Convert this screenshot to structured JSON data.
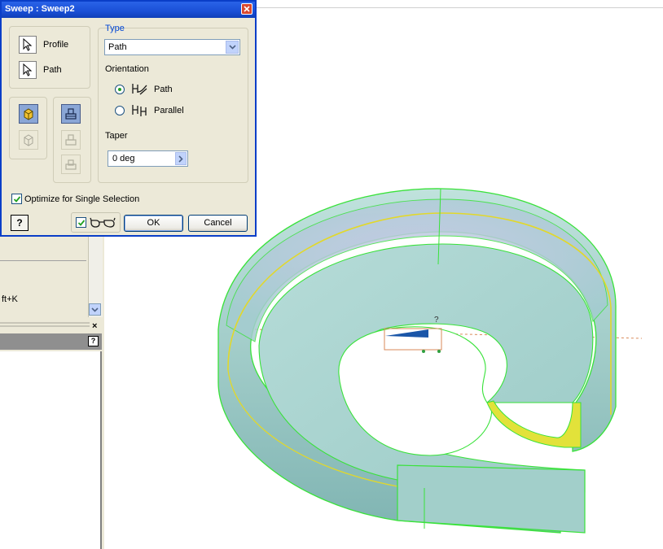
{
  "dialog": {
    "title": "Sweep : Sweep2",
    "selection": {
      "profile_label": "Profile",
      "path_label": "Path"
    },
    "type": {
      "title": "Type",
      "value": "Path"
    },
    "orientation": {
      "title": "Orientation",
      "options": [
        {
          "label": "Path",
          "selected": true
        },
        {
          "label": "Parallel",
          "selected": false
        }
      ]
    },
    "taper": {
      "title": "Taper",
      "value": "0 deg"
    },
    "optimize_label": "Optimize for Single Selection",
    "optimize_checked": true,
    "buttons": {
      "ok": "OK",
      "cancel": "Cancel",
      "help": "?"
    }
  },
  "left_panel": {
    "shortcut_text": "ft+K",
    "help_small": "?",
    "close": "×"
  },
  "colors": {
    "accent": "#0a3ec8",
    "model_fill": "#a7d3cf",
    "model_edge": "#39e23a",
    "path_highlight": "#e2d82a"
  }
}
